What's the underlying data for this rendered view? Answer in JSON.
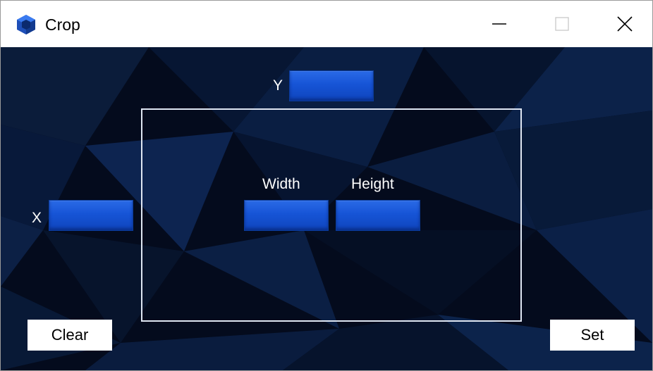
{
  "window": {
    "title": "Crop",
    "app_icon": "blue-cube-icon",
    "controls": {
      "minimize": "minimize-icon",
      "maximize": "maximize-icon",
      "close": "close-icon"
    }
  },
  "fields": {
    "y": {
      "label": "Y",
      "value": ""
    },
    "x": {
      "label": "X",
      "value": ""
    },
    "width": {
      "label": "Width",
      "value": ""
    },
    "height": {
      "label": "Height",
      "value": ""
    }
  },
  "buttons": {
    "clear": "Clear",
    "set": "Set"
  },
  "colors": {
    "background": "#040b1d",
    "field_fill": "#1654d6",
    "frame_border": "#dfe6f2",
    "label_text": "#ffffff"
  }
}
